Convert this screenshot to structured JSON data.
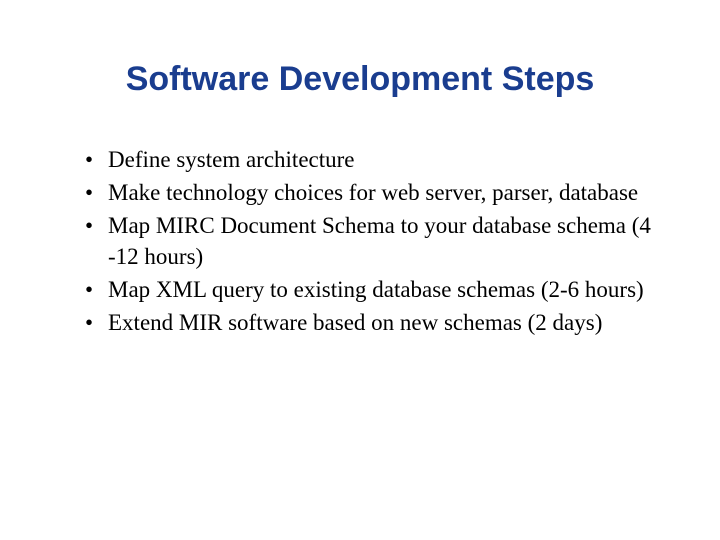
{
  "slide": {
    "title": "Software Development Steps",
    "bullets": [
      "Define system architecture",
      "Make technology choices for web server, parser, database",
      "Map MIRC Document Schema to your database schema (4 -12 hours)",
      "Map XML query to existing database schemas (2-6 hours)",
      "Extend MIR software based on new schemas (2 days)"
    ]
  }
}
